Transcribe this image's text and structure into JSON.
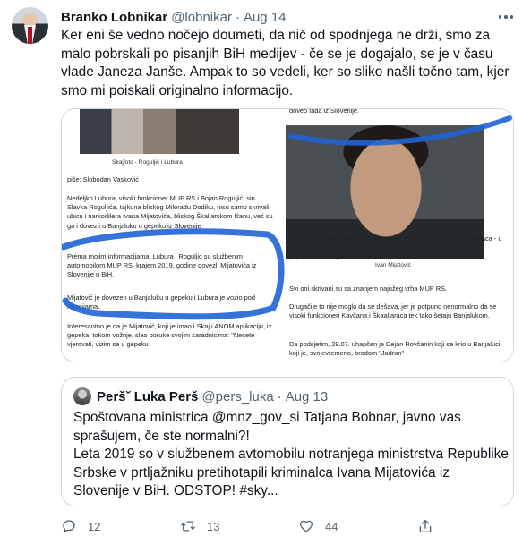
{
  "tweet": {
    "author_name": "Branko Lobnikar",
    "handle": "@lobnikar",
    "separator": "·",
    "date": "Aug 14",
    "text": "Ker eni še vedno nočejo doumeti, da nič od spodnjega ne drži, smo za malo pobrskali po pisanjih BiH medijev - če se je dogajalo, se je v času vlade Janeza Janše. Ampak to so vedeli, ker so sliko našli točno tam, kjer smo mi poiskali originalno informacijo."
  },
  "media": {
    "left_doc": {
      "caption": "Skajfoto - Rogulјić i Lubura",
      "author": "piše: Slobodan Vasković",
      "para1": "Nedeljko Lubura, visoki funkcioner MUP RS i Bojan Roguljić, sin Slavka Roguljića, tajkuna bliskog Miloradu Dodiku, nisu samo skrivali ubicu i narkodilera Ivana Mijatovića, bliskog Škaljarskom klanu, već su ga i dovezli u Banjaluku u gepeku iz Slovenije",
      "para2": "Prema mojim informacijama, Lubura i Roguljić su službenim automobilom MUP RS, krajem 2019. godine dovezli Mijatovića iz Slovenije u BiH.",
      "para3": "Mijatović je dovezen u Banjaluku u gepeku i Lubura je vozio pod rotacijama.",
      "para4": "Interesantno je da je Mijatović, koji je imao i Skaj i ANOM aplikaciju, iz gepeka, tokom vožnje, slao poruke svojim saradnicima: \"Nećete vjerovati, vizim se u gepeku"
    },
    "right_doc": {
      "top_line": "doveo tada iz Slovenije.",
      "caption": "Ivan Mijatović",
      "para1": "Banjaluka je tako postala mjesto za skrivanje crnogorskih kriminalaca - u posljednjih par mjeseci uhapšeno je nekoliko visokopozicioniranih pripadnika Crnogorskih Klanova.",
      "para2": "Svi oni skrivani su sa znanjem najužeg vrha MUP RS.",
      "para3": "Drugačije to nije moglo da se dešava, jer je potpuno nenormalno da se visoki funkcioneri Kavčana i Škaaljaraca tek tako šetaju Banjalukom.",
      "para4": "Da podsjetim, 29.07. uhapšen je Dejan Rovčanin koji se krio u Banjaluci koji je, svojevremeno, brodom \"Jadran\""
    },
    "annotation_color": "#1f63d6"
  },
  "quote": {
    "author_name": "Peršˇ Luka Perš",
    "handle": "@pers_luka",
    "separator": "·",
    "date": "Aug 13",
    "text": "Spoštovana ministrica @mnz_gov_si Tatjana Bobnar, javno vas sprašujem, če ste normalni?!\nLeta 2019 so v službenem avtomobilu notranjega ministrstva Republike Srbske v prtljažniku pretihotapili kriminalca Ivana Mijatovića iz Slovenije v BiH. ODSTOP! #sky..."
  },
  "actions": {
    "reply_count": "12",
    "retweet_count": "13",
    "like_count": "44",
    "reply_icon": "reply-icon",
    "retweet_icon": "retweet-icon",
    "like_icon": "heart-icon",
    "share_icon": "share-icon"
  },
  "colors": {
    "text": "#0f1419",
    "secondary": "#536471",
    "border": "#cfd9de"
  }
}
